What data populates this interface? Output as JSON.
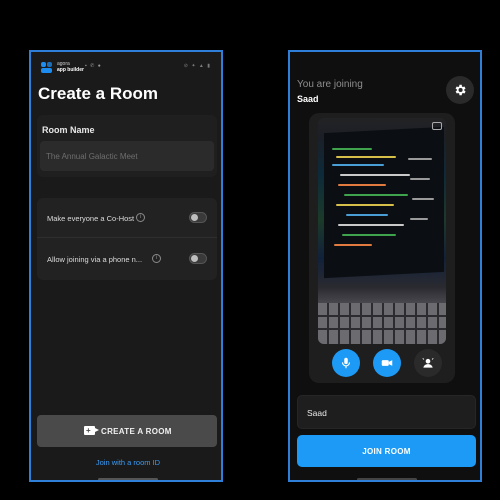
{
  "left": {
    "brand_line1": "agora",
    "brand_line2": "app builder",
    "status_left": "▪ ✆ ●",
    "status_right": "⊘ ✦ ▲ ▮",
    "title": "Create a Room",
    "room_name_label": "Room Name",
    "room_name_placeholder": "The Annual Galactic Meet",
    "options": [
      {
        "label": "Make everyone a Co-Host",
        "enabled": false
      },
      {
        "label": "Allow joining via a phone n...",
        "enabled": false
      }
    ],
    "create_button_label": "CREATE A ROOM",
    "join_link": "Join with a room ID"
  },
  "right": {
    "joining_label": "You are joining",
    "joining_name": "Saad",
    "name_input_value": "Saad",
    "join_button_label": "JOIN ROOM"
  },
  "colors": {
    "accent": "#1c9af5",
    "frame_border": "#2f7fd8",
    "link": "#3a9cf5"
  },
  "icons": {
    "settings": "gear-icon",
    "mic": "microphone-icon",
    "camera": "video-camera-icon",
    "effects": "person-effects-icon",
    "info": "info-icon",
    "create": "video-add-icon"
  }
}
